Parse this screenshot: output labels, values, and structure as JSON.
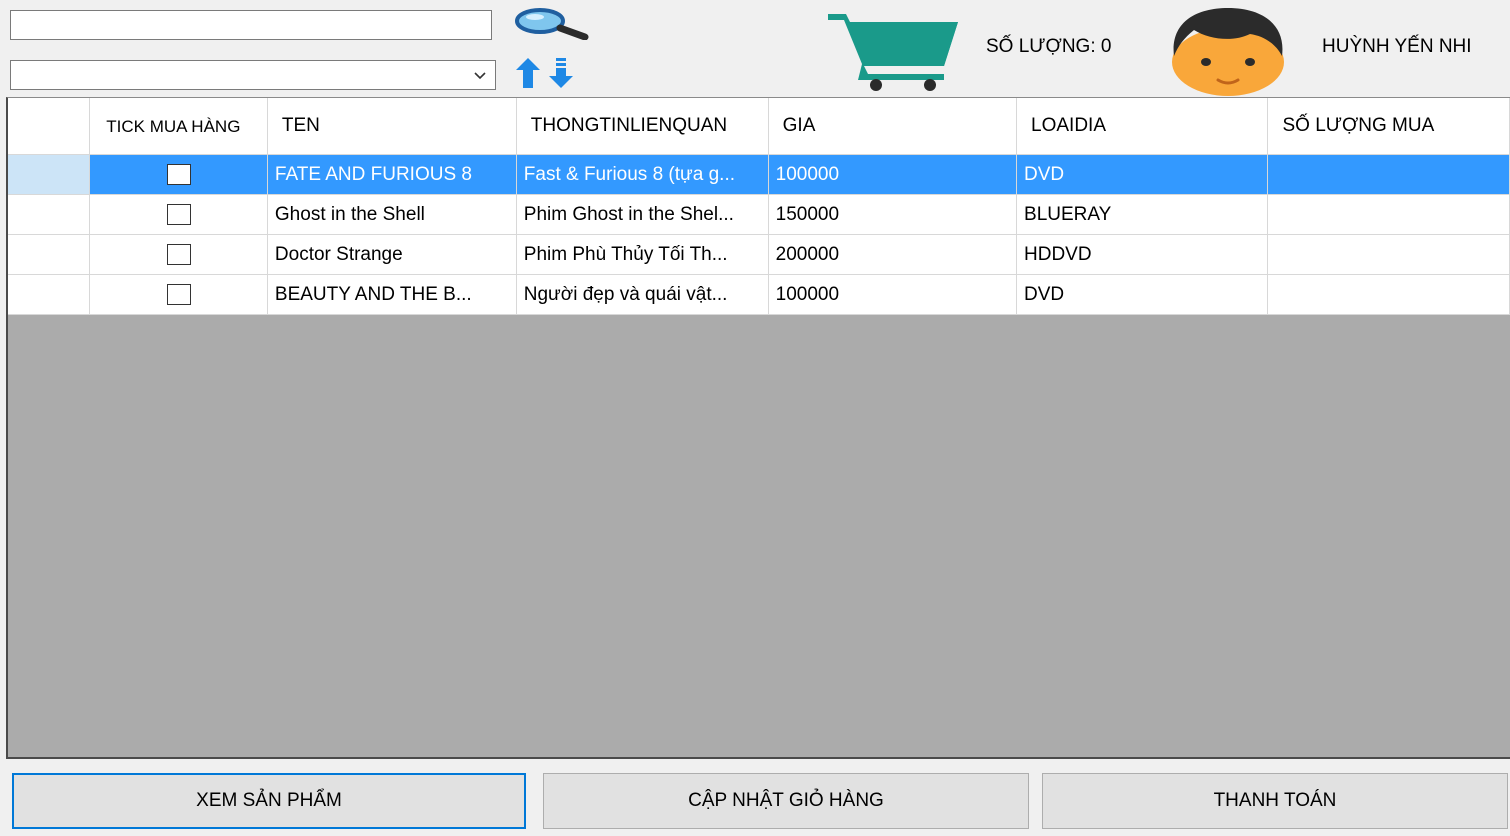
{
  "header": {
    "search_value": "",
    "sort_selected": "",
    "qty_label": "SỐ LƯỢNG: 0",
    "user_name": "HUỲNH YẾN NHI"
  },
  "icons": {
    "search": "search-icon",
    "sort": "sort-asc-desc-icon",
    "cart": "cart-icon",
    "avatar": "avatar"
  },
  "colors": {
    "cart_teal": "#1a9a8a",
    "selection_blue": "#3399ff",
    "grid_background": "#ababab",
    "focus_border": "#0078d7"
  },
  "table": {
    "columns": [
      "TICK MUA HÀNG",
      "TEN",
      "THONGTINLIENQUAN",
      "GIA",
      "LOAIDIA",
      "SỐ LƯỢNG MUA"
    ],
    "rows": [
      {
        "ten": "FATE AND FURIOUS 8",
        "thongtin": "Fast & Furious 8 (tựa g...",
        "gia": "100000",
        "loaidia": "DVD",
        "soluong": "",
        "selected": true
      },
      {
        "ten": "Ghost in the Shell",
        "thongtin": "Phim Ghost in the Shel...",
        "gia": "150000",
        "loaidia": "BLUERAY",
        "soluong": ""
      },
      {
        "ten": "Doctor Strange",
        "thongtin": "Phim Phù Thủy Tối Th...",
        "gia": "200000",
        "loaidia": "HDDVD",
        "soluong": ""
      },
      {
        "ten": "BEAUTY AND THE B...",
        "thongtin": "Người đẹp và quái vật...",
        "gia": "100000",
        "loaidia": "DVD",
        "soluong": ""
      }
    ]
  },
  "buttons": {
    "view": "XEM SẢN PHẨM",
    "update": "CẬP NHẬT GIỎ HÀNG",
    "pay": "THANH TOÁN"
  }
}
